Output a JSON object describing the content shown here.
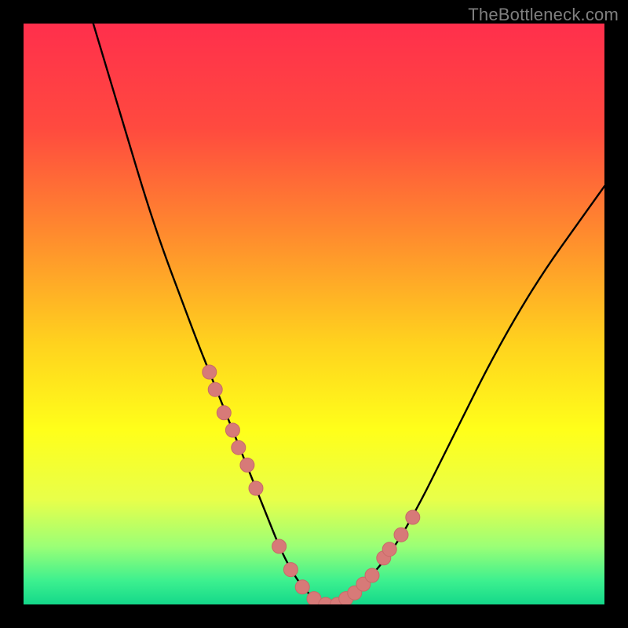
{
  "watermark": "TheBottleneck.com",
  "colors": {
    "frame": "#000000",
    "curve": "#000000",
    "marker_fill": "#d77a78",
    "marker_stroke": "#c76a68",
    "gradient_stops": [
      {
        "offset": 0.0,
        "color": "#ff2f4c"
      },
      {
        "offset": 0.18,
        "color": "#ff4a3f"
      },
      {
        "offset": 0.36,
        "color": "#ff8a2e"
      },
      {
        "offset": 0.55,
        "color": "#ffd21e"
      },
      {
        "offset": 0.7,
        "color": "#ffff1a"
      },
      {
        "offset": 0.82,
        "color": "#e8ff4a"
      },
      {
        "offset": 0.9,
        "color": "#9bff76"
      },
      {
        "offset": 0.96,
        "color": "#3cf08f"
      },
      {
        "offset": 1.0,
        "color": "#14d88a"
      }
    ]
  },
  "chart_data": {
    "type": "line",
    "title": "",
    "xlabel": "",
    "ylabel": "",
    "xlim": [
      0,
      100
    ],
    "ylim": [
      0,
      100
    ],
    "grid": false,
    "series": [
      {
        "name": "bottleneck-curve",
        "x": [
          12,
          15,
          18,
          21,
          24,
          27,
          30,
          32,
          34,
          36,
          38,
          40,
          42,
          44,
          46,
          48,
          50,
          52,
          54,
          57,
          60,
          64,
          68,
          72,
          76,
          80,
          85,
          90,
          95,
          100
        ],
        "y": [
          100,
          90,
          80,
          70,
          61,
          53,
          45,
          40,
          35,
          30,
          25,
          20,
          15,
          10,
          6,
          3,
          1,
          0,
          0,
          2,
          5,
          10,
          17,
          25,
          33,
          41,
          50,
          58,
          65,
          72
        ]
      }
    ],
    "markers": {
      "name": "highlight-points",
      "x": [
        32,
        33,
        34.5,
        36,
        37,
        38.5,
        40,
        44,
        46,
        48,
        50,
        52,
        54,
        55.5,
        57,
        58.5,
        60,
        62,
        63,
        65,
        67
      ],
      "y": [
        40,
        37,
        33,
        30,
        27,
        24,
        20,
        10,
        6,
        3,
        1,
        0,
        0,
        1,
        2,
        3.5,
        5,
        8,
        9.5,
        12,
        15
      ]
    }
  }
}
